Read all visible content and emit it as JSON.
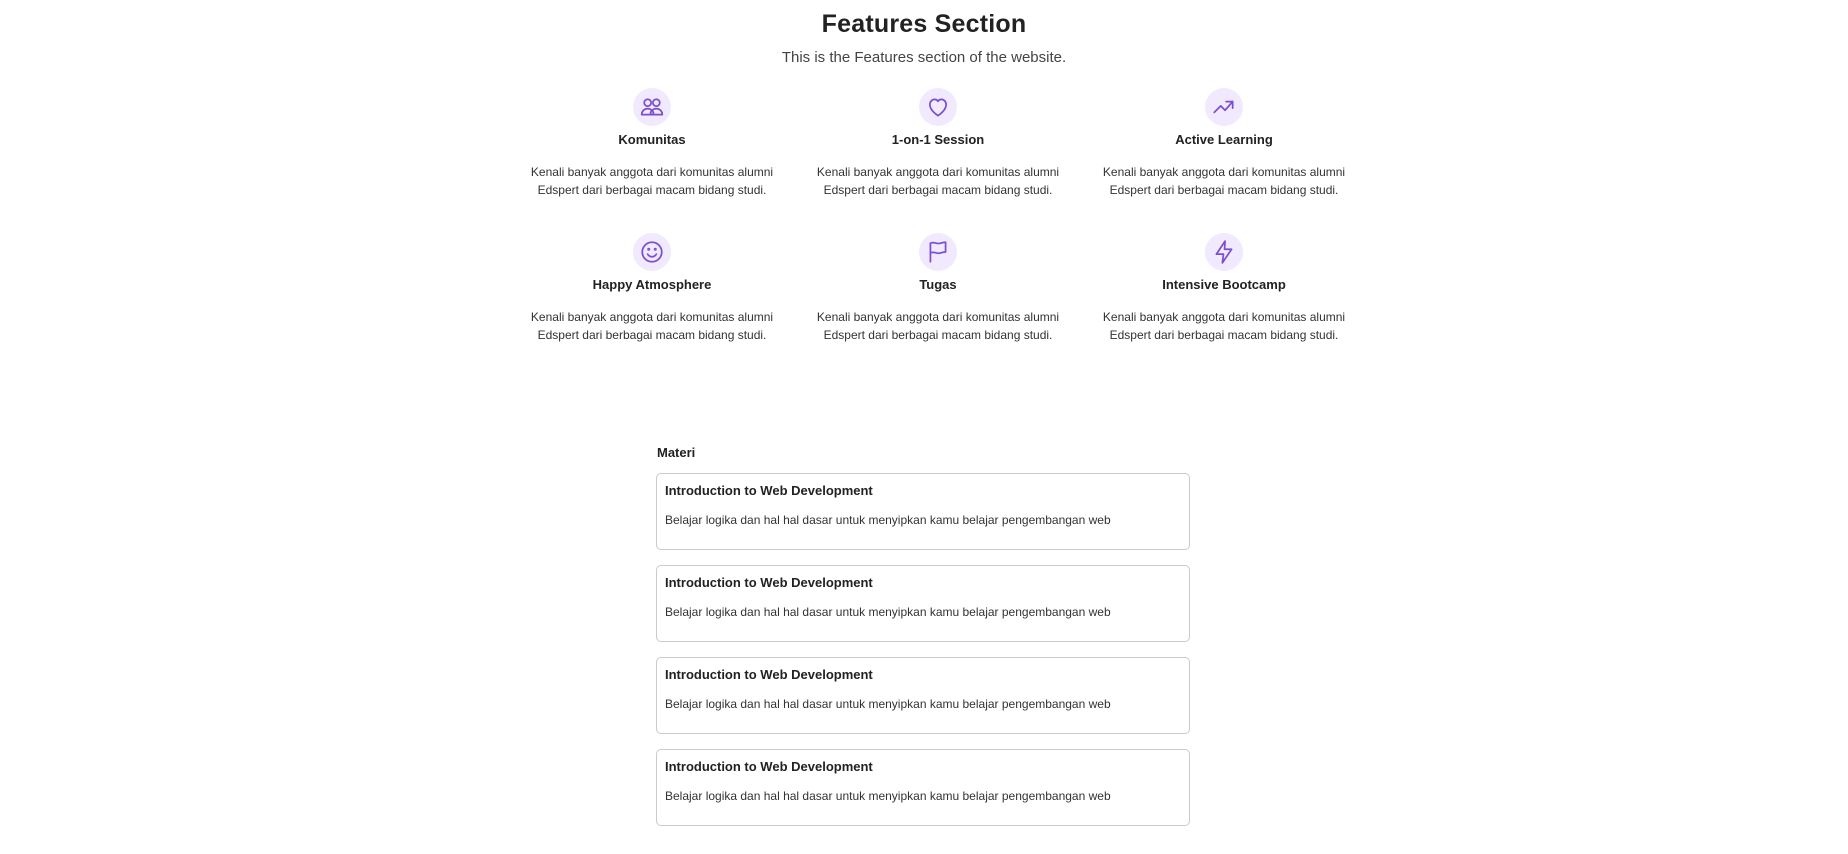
{
  "features": {
    "title": "Features Section",
    "subtitle": "This is the Features section of the website.",
    "items": [
      {
        "icon": "users-icon",
        "title": "Komunitas",
        "desc": "Kenali banyak anggota dari komunitas alumni Edspert dari berbagai macam bidang studi."
      },
      {
        "icon": "heart-icon",
        "title": "1-on-1 Session",
        "desc": "Kenali banyak anggota dari komunitas alumni Edspert dari berbagai macam bidang studi."
      },
      {
        "icon": "trending-up-icon",
        "title": "Active Learning",
        "desc": "Kenali banyak anggota dari komunitas alumni Edspert dari berbagai macam bidang studi."
      },
      {
        "icon": "smile-icon",
        "title": "Happy Atmosphere",
        "desc": "Kenali banyak anggota dari komunitas alumni Edspert dari berbagai macam bidang studi."
      },
      {
        "icon": "flag-icon",
        "title": "Tugas",
        "desc": "Kenali banyak anggota dari komunitas alumni Edspert dari berbagai macam bidang studi."
      },
      {
        "icon": "lightning-icon",
        "title": "Intensive Bootcamp",
        "desc": "Kenali banyak anggota dari komunitas alumni Edspert dari berbagai macam bidang studi."
      }
    ]
  },
  "materi": {
    "label": "Materi",
    "items": [
      {
        "title": "Introduction to Web Development",
        "desc": "Belajar logika dan hal hal dasar untuk menyipkan kamu belajar pengembangan web"
      },
      {
        "title": "Introduction to Web Development",
        "desc": "Belajar logika dan hal hal dasar untuk menyipkan kamu belajar pengembangan web"
      },
      {
        "title": "Introduction to Web Development",
        "desc": "Belajar logika dan hal hal dasar untuk menyipkan kamu belajar pengembangan web"
      },
      {
        "title": "Introduction to Web Development",
        "desc": "Belajar logika dan hal hal dasar untuk menyipkan kamu belajar pengembangan web"
      }
    ]
  },
  "colors": {
    "accent": "#7c4fd0",
    "icon_bg": "#f1e9fd",
    "card_border": "#c9c9cf"
  }
}
